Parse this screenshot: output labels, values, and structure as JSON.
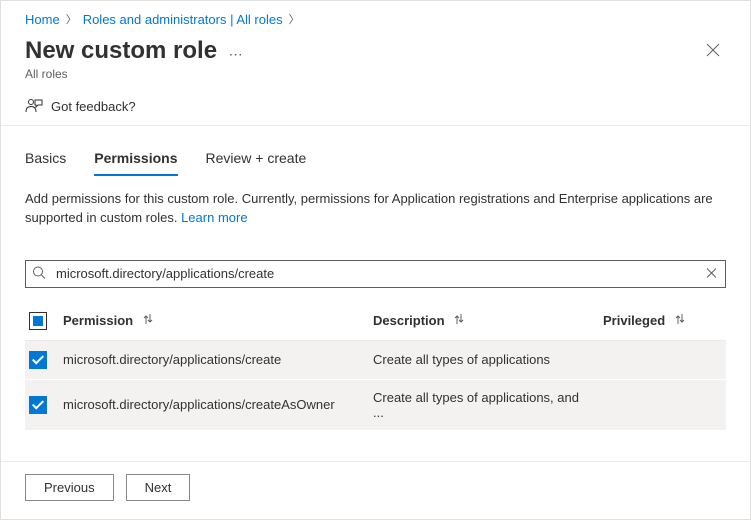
{
  "breadcrumb": {
    "home": "Home",
    "roles": "Roles and administrators | All roles"
  },
  "header": {
    "title": "New custom role",
    "subtitle": "All roles"
  },
  "feedback": {
    "label": "Got feedback?"
  },
  "tabs": {
    "basics": "Basics",
    "permissions": "Permissions",
    "review": "Review + create"
  },
  "description": {
    "text": "Add permissions for this custom role. Currently, permissions for Application registrations and Enterprise applications are supported in custom roles. ",
    "learn_more": "Learn more"
  },
  "search": {
    "value": "microsoft.directory/applications/create"
  },
  "table": {
    "headers": {
      "permission": "Permission",
      "description": "Description",
      "privileged": "Privileged"
    },
    "rows": [
      {
        "permission": "microsoft.directory/applications/create",
        "description": "Create all types of applications",
        "checked": true
      },
      {
        "permission": "microsoft.directory/applications/createAsOwner",
        "description": "Create all types of applications, and ...",
        "checked": true
      }
    ]
  },
  "footer": {
    "previous": "Previous",
    "next": "Next"
  }
}
